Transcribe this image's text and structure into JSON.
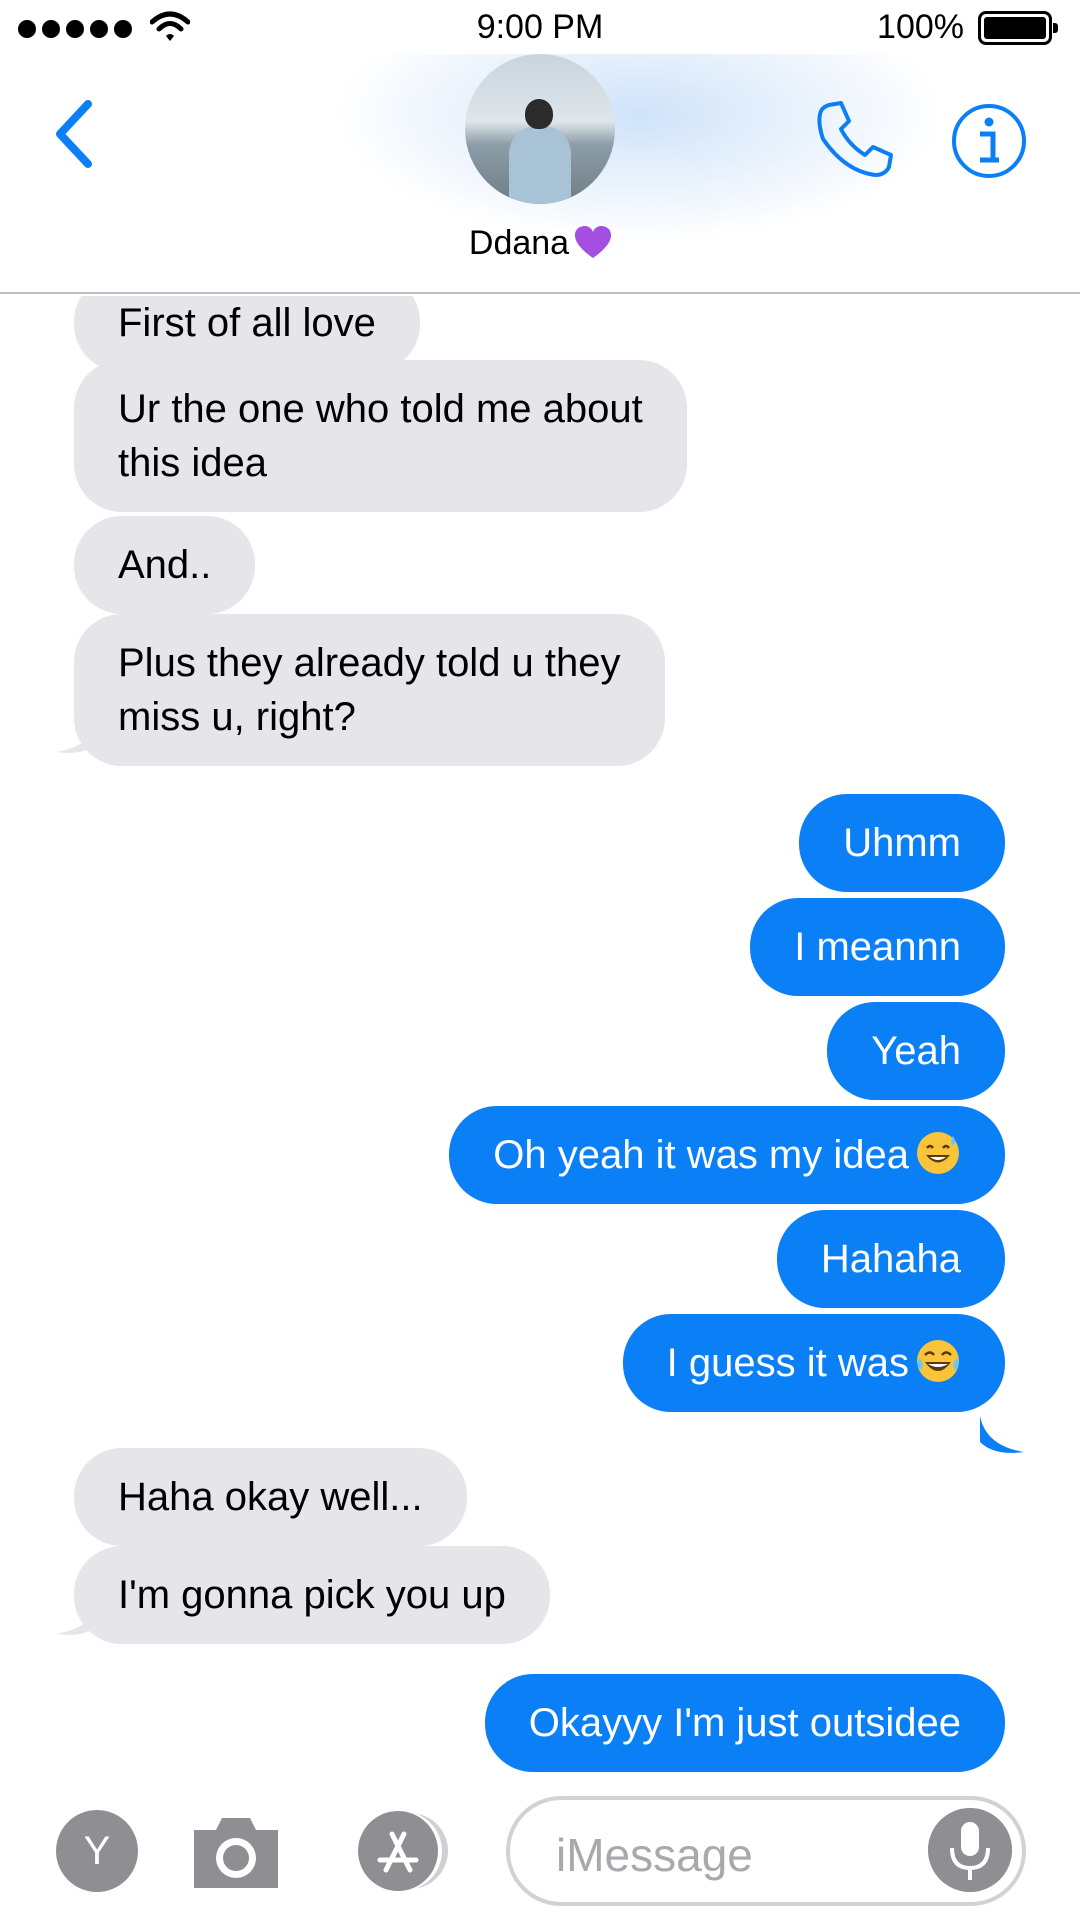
{
  "status_bar": {
    "time": "9:00 PM",
    "battery": "100%",
    "signal_bars": 5
  },
  "header": {
    "contact_name": "Ddana",
    "back_icon": "chevron-left-icon",
    "call_icon": "phone-icon",
    "info_icon": "info-icon",
    "accent_color": "#0b7ff5"
  },
  "messages": [
    {
      "dir": "in",
      "text": "First of all love"
    },
    {
      "dir": "in",
      "lines": [
        "Ur the one who told me about",
        "this idea"
      ]
    },
    {
      "dir": "in",
      "text": "And.."
    },
    {
      "dir": "in",
      "lines": [
        "Plus they already told u they",
        "miss u, right?"
      ]
    },
    {
      "dir": "out",
      "text": "Uhmm"
    },
    {
      "dir": "out",
      "text": "I meannn"
    },
    {
      "dir": "out",
      "text": "Yeah"
    },
    {
      "dir": "out",
      "text": "Oh yeah it was my idea",
      "emoji": "sweat-smile-emoji"
    },
    {
      "dir": "out",
      "text": "Hahaha"
    },
    {
      "dir": "out",
      "text": "I guess it was",
      "emoji": "tears-of-joy-emoji"
    },
    {
      "dir": "in",
      "text": "Haha okay well..."
    },
    {
      "dir": "in",
      "text": "I'm gonna pick you up"
    },
    {
      "dir": "out",
      "text": "Okayyy I'm just outsidee"
    }
  ],
  "bottom_bar": {
    "app_y_label": "Y",
    "input_placeholder": "iMessage",
    "camera_icon": "camera-icon",
    "appstore_icon": "app-store-icon",
    "mic_icon": "microphone-icon"
  },
  "colors": {
    "incoming_bubble": "#e5e5ea",
    "outgoing_bubble": "#0b7ff5"
  }
}
